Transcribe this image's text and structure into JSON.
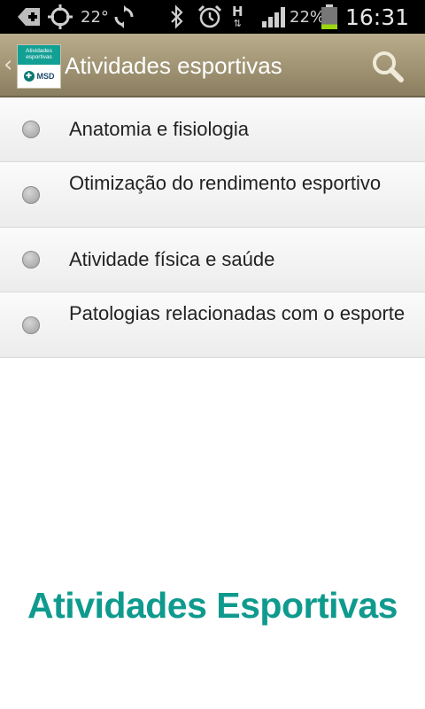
{
  "status_bar": {
    "icons": [
      "add-box-icon",
      "gps-icon",
      "sync-icon",
      "bluetooth-icon",
      "alarm-icon",
      "network-h-icon",
      "signal-icon",
      "battery-icon"
    ],
    "temperature": "22°",
    "network_type": "H",
    "battery_percent": "22%",
    "battery_level": 0.22,
    "time": "16:31"
  },
  "action_bar": {
    "title": "Atividades esportivas",
    "logo_caption": "Atividades esportivas",
    "logo_brand": "MSD",
    "search_icon": "search-icon",
    "color_accent": "#9f9373"
  },
  "list": {
    "items": [
      {
        "label": "Anatomia e fisiologia"
      },
      {
        "label": "Otimização do rendimento esportivo"
      },
      {
        "label": "Atividade física e saúde"
      },
      {
        "label": "Patologias relacionadas com o esporte"
      }
    ]
  },
  "footer": {
    "brand_text": "Atividades Esportivas",
    "brand_color": "#0f9a8e"
  }
}
